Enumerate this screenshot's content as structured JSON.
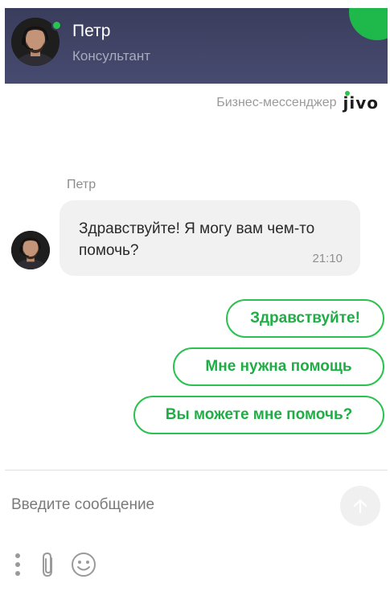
{
  "header": {
    "agent_name": "Петр",
    "agent_role": "Консультант",
    "status_color": "#2bc24f",
    "background_color": "#3f4263"
  },
  "branding": {
    "label": "Бизнес-мессенджер",
    "logo_text": "jivo"
  },
  "conversation": {
    "messages": [
      {
        "sender": "Петр",
        "text": "Здравствуйте! Я могу вам чем-то помочь?",
        "time": "21:10"
      }
    ],
    "quick_replies": [
      "Здравствуйте!",
      "Мне нужна помощь",
      "Вы можете мне помочь?"
    ]
  },
  "composer": {
    "placeholder": "Введите сообщение",
    "value": "",
    "send_icon": "arrow-up-icon"
  },
  "toolbar": {
    "icons": [
      "more-vertical-icon",
      "paperclip-icon",
      "emoji-icon"
    ]
  },
  "colors": {
    "accent": "#2bc24f",
    "bubble": "#f1f1f1"
  }
}
